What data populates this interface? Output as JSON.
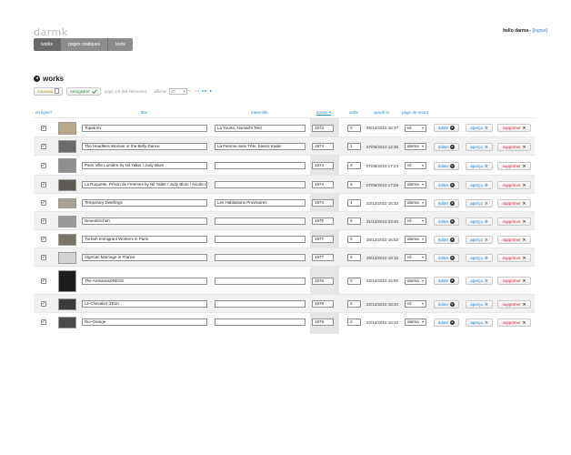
{
  "app": {
    "logo": "darmk",
    "greeting": "hello darma -",
    "logout": "[logout]"
  },
  "nav": [
    {
      "label": "works",
      "active": true
    },
    {
      "label": "pages statiques",
      "active": false
    },
    {
      "label": "texts",
      "active": false
    }
  ],
  "section": {
    "icon": "◂",
    "title": "works"
  },
  "toolbar": {
    "nouveau_label": "nouveau",
    "enregistrer_label": "enregistrer",
    "page_info": "page 1/3 (56 éléments)",
    "afficher_label": "afficher",
    "per_page": "20",
    "pager_prev": "◂ ◂◂",
    "pager_next": "▸▸ ▸"
  },
  "columns": {
    "en_ligne": "en ligne?",
    "titre": "titre",
    "meta_title": "meta-title",
    "annee": "année ▾",
    "ordre": "ordre",
    "ajoute_le": "ajouté le",
    "page_de_retour": "page de retour"
  },
  "actions": {
    "editer": "éditer",
    "apercu": "aperçu",
    "supprimer": "supprimer"
  },
  "rows": [
    {
      "titre": "Topak Ev",
      "meta": "La Yourte, Nomad's Tent",
      "annee": "1973",
      "ordre": "0",
      "date": "25/12/2010 16:37",
      "retour": "nil",
      "thumb": "#b9a98a"
    },
    {
      "titre": "The Headless Woman or the Belly Dance",
      "meta": "La Femme sans Tête, bassiz Kadin",
      "annee": "1974",
      "ordre": "1",
      "date": "07/06/2010 12:35",
      "retour": "darma",
      "thumb": "#6b6b6b"
    },
    {
      "titre": "Paris Ville Lumière by Nil Yalter / Judy Blum",
      "meta": "",
      "annee": "1974",
      "ordre": "2",
      "date": "07/06/2010 17:24",
      "retour": "nil",
      "thumb": "#8e8e8e"
    },
    {
      "titre": "La Roquette, Prison de Femmes by Nil Yalter / Judy Blum / Nicole Croiset",
      "meta": "",
      "annee": "1974",
      "ordre": "3",
      "date": "07/06/2010 17:29",
      "retour": "darma",
      "thumb": "#5e5a52"
    },
    {
      "titre": "Temporary Dwellings",
      "meta": "Les Habitations Provisoires",
      "annee": "1974",
      "ordre": "4",
      "date": "22/12/2010 15:33",
      "retour": "darma",
      "thumb": "#a9a295"
    },
    {
      "titre": "Neuenkirchen",
      "meta": "",
      "annee": "1975",
      "ordre": "0",
      "date": "21/12/2010 23:40",
      "retour": "nil",
      "thumb": "#9a9a9a"
    },
    {
      "titre": "Turkish Immigrant Workers in Paris",
      "meta": "",
      "annee": "1977",
      "ordre": "0",
      "date": "25/12/2010 16:53",
      "retour": "darma",
      "thumb": "#7a7466"
    },
    {
      "titre": "Algerian Marriage in France",
      "meta": "",
      "annee": "1977",
      "ordre": "0",
      "date": "26/12/2010 19:15",
      "retour": "nil",
      "thumb": "#d2d2d2"
    },
    {
      "titre": "The AmbassaDRESS",
      "meta": "",
      "annee": "1978",
      "ordre": "0",
      "date": "22/12/2010 15:55",
      "retour": "darma",
      "thumb": "#1c1c1c"
    },
    {
      "titre": "Le Chevalier d'Eon",
      "meta": "",
      "annee": "1978",
      "ordre": "0",
      "date": "22/12/2010 16:34",
      "retour": "nil",
      "thumb": "#3c3c3c"
    },
    {
      "titre": "Rio-Orange",
      "meta": "",
      "annee": "1979",
      "ordre": "2",
      "date": "22/12/2010 16:12",
      "retour": "darma",
      "thumb": "#4a4a4a"
    }
  ]
}
